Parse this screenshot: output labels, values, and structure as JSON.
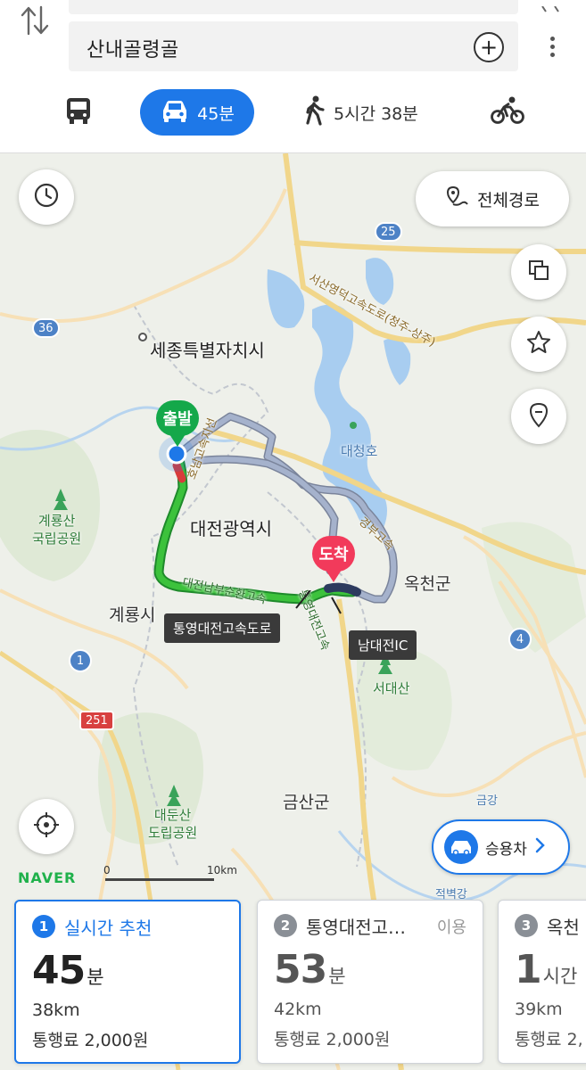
{
  "header": {
    "destination": "산내골령골",
    "add_stop_symbol": "+",
    "modes": [
      {
        "id": "bus",
        "icon": "bus-icon",
        "label": ""
      },
      {
        "id": "car",
        "icon": "car-icon",
        "label": "45분",
        "selected": true
      },
      {
        "id": "walk",
        "icon": "walk-icon",
        "label": "5시간 38분"
      },
      {
        "id": "bike",
        "icon": "bike-icon",
        "label": ""
      }
    ]
  },
  "map": {
    "full_route_label": "전체경로",
    "start_pin": "출발",
    "end_pin": "도착",
    "callouts": {
      "road": "통영대전고속도로",
      "ic": "남대전IC"
    },
    "places": {
      "sejong": "세종특별자치시",
      "daejeon": "대전광역시",
      "gyeryong": "계룡시",
      "okcheon": "옥천군",
      "geumsan": "금산군",
      "daecheongho": "대청호",
      "gyeryongsan": "계룡산\n국립공원",
      "daedunsan": "대둔산\n도립공원",
      "seodaesan": "서대산"
    },
    "road_labels": {
      "seosan_yeongdeok": "서산영덕고속도로(청주-상주)",
      "gyeongbu": "경부고속",
      "nambu_sunhwan": "대전남부순환고속",
      "tongyeong_daejeon": "통영대전고속",
      "honam_jiseon": "호남고속지선",
      "geumgang": "금강",
      "jeonbyeonggang": "적벽강"
    },
    "shields": {
      "r25": "25",
      "r36": "36",
      "r4": "4",
      "r1": "1",
      "r251": "251"
    },
    "car_type_label": "승용차",
    "brand": "NAVER",
    "scale": {
      "start": "0",
      "end": "10km"
    }
  },
  "routes": [
    {
      "rank": "1",
      "name": "실시간 추천",
      "note": "",
      "time_value": "45",
      "time_unit": "분",
      "distance": "38km",
      "toll": "통행료 2,000원",
      "selected": true
    },
    {
      "rank": "2",
      "name": "통영대전고…",
      "note": "이용",
      "time_value": "53",
      "time_unit": "분",
      "distance": "42km",
      "toll": "통행료 2,000원",
      "selected": false
    },
    {
      "rank": "3",
      "name": "옥천",
      "note": "",
      "time_value": "1",
      "time_unit": "시간",
      "distance": "39km",
      "toll": "통행료 2,",
      "selected": false
    }
  ],
  "colors": {
    "accent": "#1e78e8",
    "route_green": "#3cc23c",
    "route_red": "#d83b3b",
    "alt_route": "#a5b2cc",
    "start_pin": "#14a84a",
    "end_pin": "#f23a5b"
  }
}
